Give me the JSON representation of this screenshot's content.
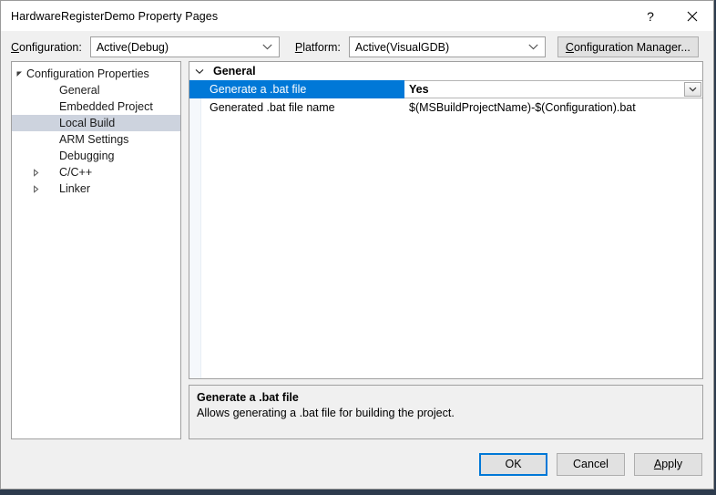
{
  "window": {
    "title": "HardwareRegisterDemo Property Pages",
    "help_label": "?",
    "close_label": "×",
    "accent_color": "#0078d7"
  },
  "config_bar": {
    "configuration_label_accel": "C",
    "configuration_label_rest": "onfiguration:",
    "configuration_value": "Active(Debug)",
    "platform_label_accel": "P",
    "platform_label_rest": "latform:",
    "platform_value": "Active(VisualGDB)",
    "config_manager_accel": "C",
    "config_manager_prefix": "",
    "config_manager_rest": "onfiguration Manager..."
  },
  "tree": {
    "items": [
      {
        "label": "Configuration Properties",
        "depth": 0,
        "state": "expanded",
        "selected": false
      },
      {
        "label": "General",
        "depth": 1,
        "state": "leaf",
        "selected": false
      },
      {
        "label": "Embedded Project",
        "depth": 1,
        "state": "leaf",
        "selected": false
      },
      {
        "label": "Local Build",
        "depth": 1,
        "state": "leaf",
        "selected": true
      },
      {
        "label": "ARM Settings",
        "depth": 1,
        "state": "leaf",
        "selected": false
      },
      {
        "label": "Debugging",
        "depth": 1,
        "state": "leaf",
        "selected": false
      },
      {
        "label": "C/C++",
        "depth": 1,
        "state": "collapsed",
        "selected": false
      },
      {
        "label": "Linker",
        "depth": 1,
        "state": "collapsed",
        "selected": false
      }
    ]
  },
  "property_grid": {
    "category": "General",
    "category_state": "expanded",
    "rows": [
      {
        "name": "Generate a .bat file",
        "value": "Yes",
        "selected": true,
        "editor": "combobox"
      },
      {
        "name": "Generated .bat file name",
        "value": "$(MSBuildProjectName)-$(Configuration).bat",
        "selected": false,
        "editor": "text"
      }
    ]
  },
  "description": {
    "title": "Generate a .bat file",
    "text": "Allows generating a .bat file for building the project."
  },
  "footer": {
    "ok_label": "OK",
    "cancel_label": "Cancel",
    "apply_accel": "A",
    "apply_rest": "pply"
  }
}
